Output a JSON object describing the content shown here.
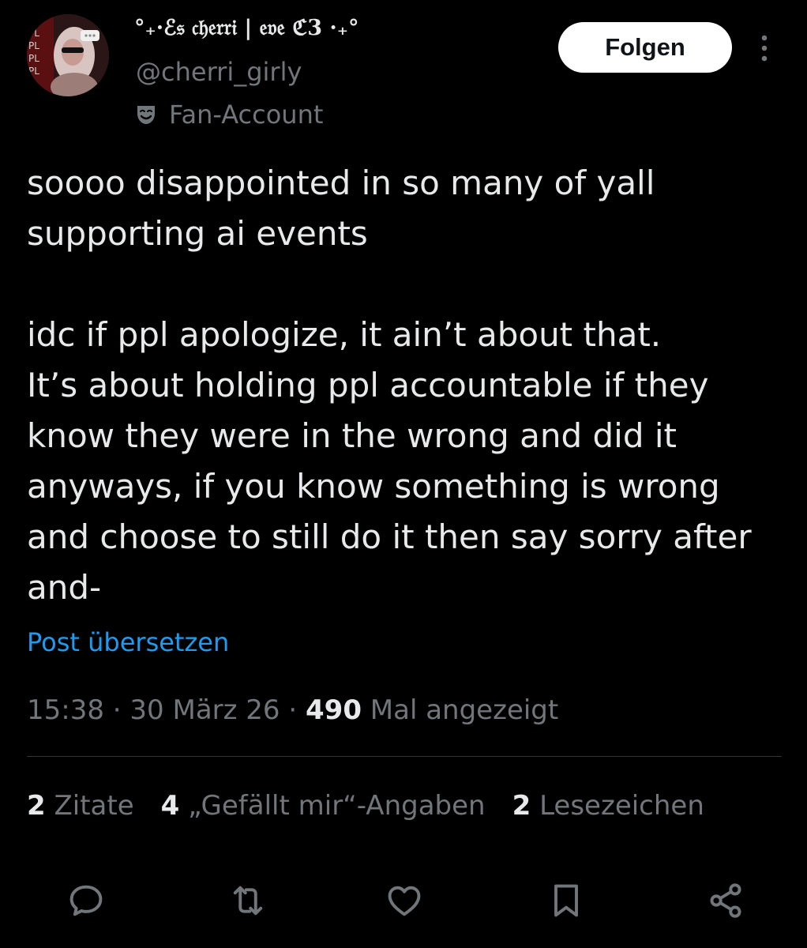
{
  "author": {
    "display_name": "°₊·ℰ𝔰 𝔠𝔥𝔢𝔯𝔯𝔦 | 𝔢𝔳𝔢 ℭ3 ·₊°",
    "handle": "@cherri_girly",
    "affiliation_label": "Fan-Account",
    "avatar_icon": "avatar-image",
    "affiliation_icon": "theater-mask-icon"
  },
  "follow_button": {
    "label": "Folgen"
  },
  "more_icon": "more-vertical-icon",
  "tweet": {
    "text": "soooo disappointed in so many of yall\nsupporting ai events\n\nidc if ppl apologize, it ain’t about that.\nIt’s about holding ppl accountable if they\nknow they were in the wrong and did it\nanyways, if you know something is wrong\nand choose to still do it then say sorry after\nand-",
    "translate_label": "Post übersetzen"
  },
  "meta": {
    "time": "15:38",
    "separator": " · ",
    "date": "30 März 26",
    "views_count": "490",
    "views_label": " Mal angezeigt"
  },
  "stats": [
    {
      "count": "2",
      "label": "Zitate"
    },
    {
      "count": "4",
      "label": "„Gefällt mir“-Angaben"
    },
    {
      "count": "2",
      "label": "Lesezeichen"
    }
  ],
  "actions": [
    {
      "name": "reply",
      "icon": "reply-icon"
    },
    {
      "name": "repost",
      "icon": "repost-icon"
    },
    {
      "name": "like",
      "icon": "heart-icon"
    },
    {
      "name": "bookmark",
      "icon": "bookmark-icon"
    },
    {
      "name": "share",
      "icon": "share-icon"
    }
  ],
  "colors": {
    "background": "#000000",
    "text_primary": "#e7e9ea",
    "text_secondary": "#71767b",
    "link": "#1d9bf0",
    "divider": "#2f3336",
    "button_bg": "#ffffff",
    "button_text": "#0f1419"
  }
}
